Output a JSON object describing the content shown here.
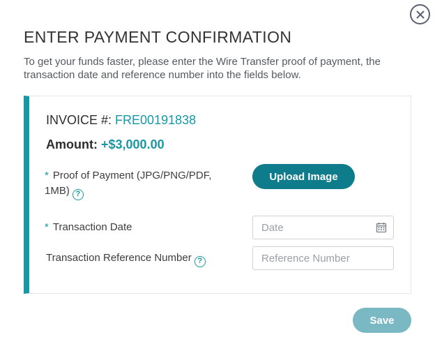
{
  "dialog": {
    "title": "ENTER PAYMENT CONFIRMATION",
    "intro": "To get your funds faster, please enter the Wire Transfer proof of payment, the transaction date and reference number into the fields below."
  },
  "invoice": {
    "label": "INVOICE #:",
    "number": "FRE00191838",
    "amount_label": "Amount:",
    "amount_value": "+$3,000.00"
  },
  "fields": {
    "required_mark": "*",
    "proof_label_line1": "Proof of Payment (JPG/PNG/PDF,",
    "proof_label_line2": "1MB)",
    "upload_label": "Upload Image",
    "date_label": "Transaction Date",
    "date_placeholder": "Date",
    "ref_label": "Transaction Reference Number",
    "ref_placeholder": "Reference Number",
    "help_glyph": "?"
  },
  "footer": {
    "save_label": "Save"
  },
  "icons": {
    "close": "close-icon",
    "help": "question-circle-icon",
    "calendar": "calendar-icon"
  },
  "colors": {
    "accent": "#1a97a4",
    "upload_button": "#0e7c8a",
    "save_button_disabled": "#7ab8c3",
    "close_icon": "#5b6072"
  }
}
